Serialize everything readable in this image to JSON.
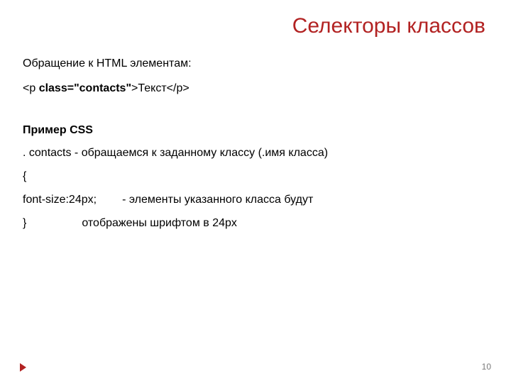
{
  "title": "Селекторы классов",
  "lines": {
    "intro": "Обращение к HTML элементам:",
    "tag_open": "<p ",
    "tag_class_attr": "class=\"contacts\"",
    "tag_after_class": ">Текст</p>",
    "css_heading": "Пример CSS",
    "css_selector": ". сontacts   - обращаемся к заданному классу (.имя класса)",
    "css_brace_open": "{",
    "css_rule": "font-size:24px;",
    "css_rule_comment": "- элементы указанного класса будут",
    "css_brace_close": "}",
    "css_rule_comment_2": "отображены шрифтом в 24px"
  },
  "page_number": "10",
  "icons": {
    "nav": "play-right-icon"
  },
  "colors": {
    "title": "#b22222",
    "text": "#000000",
    "page_number": "#7a7a7a"
  }
}
